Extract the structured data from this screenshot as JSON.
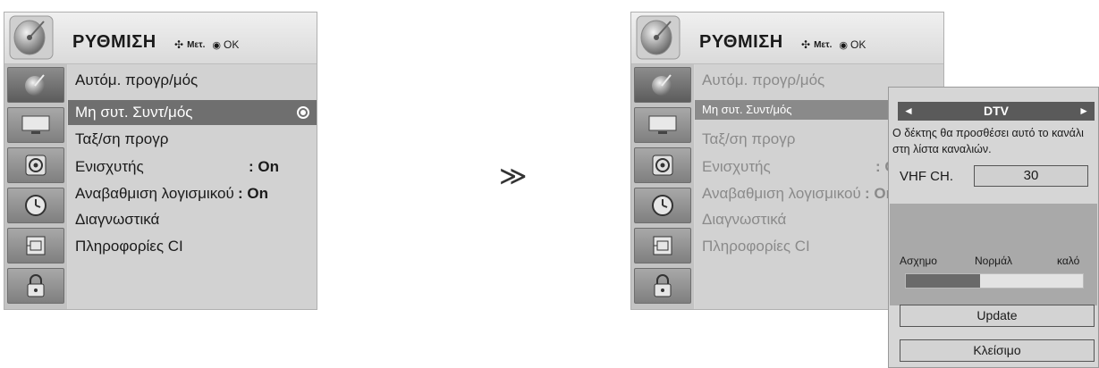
{
  "menu": {
    "title": "ΡΥΘΜΙΣΗ",
    "hint_move_symbol": "✣",
    "hint_move": "Μετ.",
    "hint_ok_symbol": "◉",
    "hint_ok": "OK",
    "icons": [
      "satellite-dish-icon",
      "monitor-icon",
      "speaker-icon",
      "clock-icon",
      "ci-module-icon",
      "padlock-icon"
    ],
    "items": [
      {
        "label": "Αυτόμ. προγρ/μός",
        "value": ""
      },
      {
        "label": "Μη συτ. Συντ/μός",
        "value": ""
      },
      {
        "label": "Ταξ/ση προγρ",
        "value": ""
      },
      {
        "label": "Ενισχυτής",
        "value": ": On"
      },
      {
        "label": "Αναβαθμιση λογισμικού",
        "value": ": On"
      },
      {
        "label": "Διαγνωστικά",
        "value": ""
      },
      {
        "label": "Πληροφορίες CI",
        "value": ""
      }
    ],
    "selected_index": 1
  },
  "right_menu": {
    "items": [
      {
        "label": "Αυτόμ. προγρ/μός",
        "value": ""
      },
      {
        "label": "Μη συτ. Συντ/μός",
        "value": ""
      },
      {
        "label": "Ταξ/ση προγρ",
        "value": ""
      },
      {
        "label": "Ενισχυτής",
        "value": ": On"
      },
      {
        "label": "Αναβαθμιση λογισμικού",
        "value": ": On"
      },
      {
        "label": "Διαγνωστικά",
        "value": ""
      },
      {
        "label": "Πληροφορίες CI",
        "value": ""
      }
    ]
  },
  "transition_arrow": "≫",
  "popup": {
    "left_arrow": "◄",
    "right_arrow": "►",
    "mode": "DTV",
    "message": "Ο δέκτης θα προσθέσει αυτό το κανάλι στη λίστα καναλιών.",
    "channel_label": "VHF CH.",
    "channel_value": "30",
    "signal_bad": "Ασχημο",
    "signal_normal": "Νορμάλ",
    "signal_good": "καλό",
    "signal_level": 0.42,
    "update_label": "Update",
    "close_label": "Κλείσιμο"
  },
  "colors": {
    "selected_row": "#6f6f6f",
    "panel_bg": "#d6d6d6",
    "signal_fill": "#6a6a6a"
  }
}
